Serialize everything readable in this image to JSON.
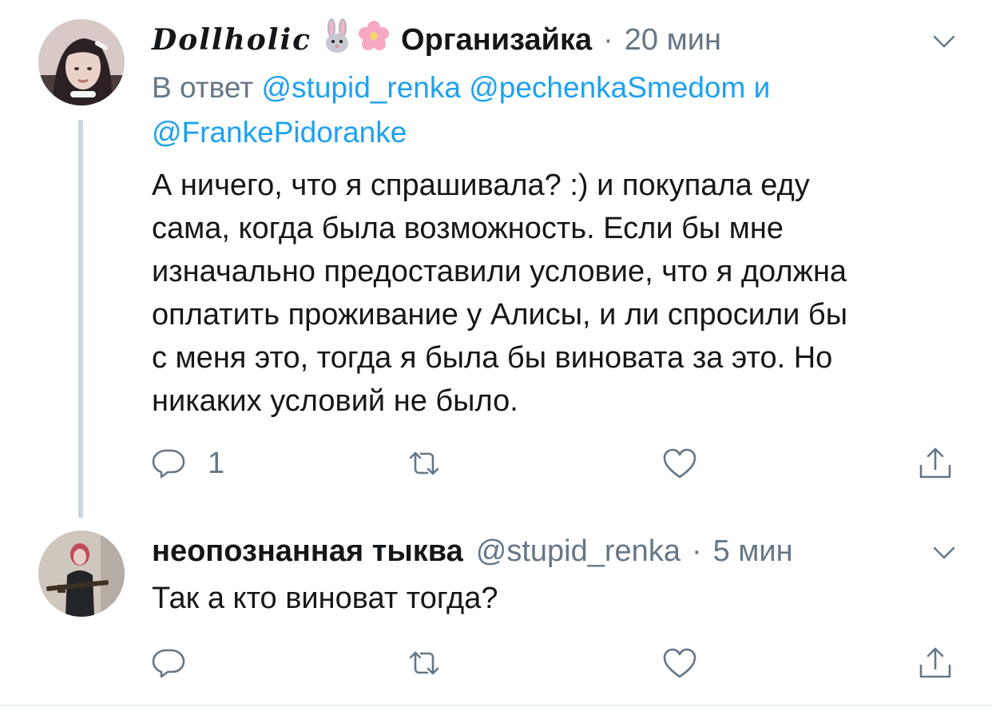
{
  "tweets": [
    {
      "display_name": "Dollholic",
      "badge_text": "Организайка",
      "time": "20 мин",
      "reply_prefix": "В ответ",
      "mentions": [
        "@stupid_renka",
        "@pechenkaSmedom",
        "@FrankePidoranke"
      ],
      "mention_joiner": "и",
      "text_lines": [
        "А ничего, что я спрашивала? :) и покупала еду",
        "сама, когда была возможность. Если бы мне",
        "изначально предоставили условие, что я должна",
        "оплатить проживание у Алисы, и ли спросили бы",
        "с меня это, тогда я была бы виновата за это. Но",
        "никаких условий не было."
      ],
      "reply_count": "1",
      "icons": [
        "rabbit-emoji",
        "flower-emoji",
        "chevron-down-icon",
        "reply-icon",
        "retweet-icon",
        "like-icon",
        "share-icon"
      ]
    },
    {
      "display_name": "неопознанная тыква",
      "handle": "@stupid_renka",
      "time": "5 мин",
      "text": "Так а кто виноват тогда?",
      "icons": [
        "chevron-down-icon",
        "reply-icon",
        "retweet-icon",
        "like-icon",
        "share-icon"
      ]
    }
  ],
  "colors": {
    "link": "#1da1f2",
    "muted": "#657786",
    "text": "#14171a",
    "thread_line": "#ccd6dd"
  }
}
